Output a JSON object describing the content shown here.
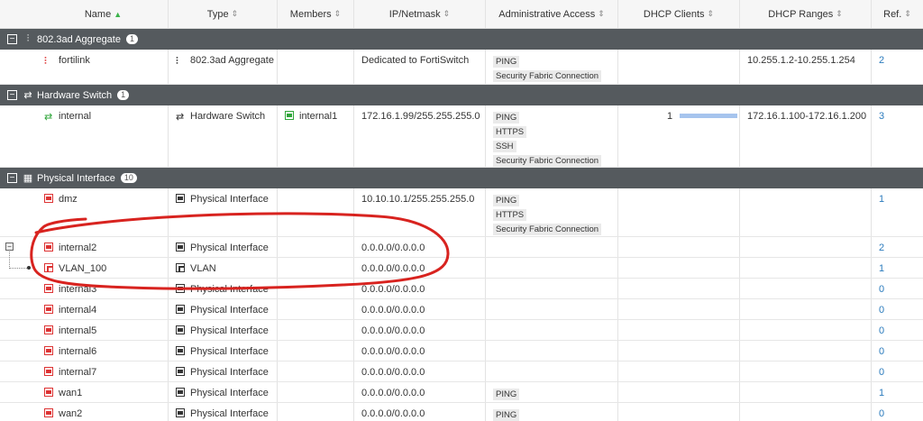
{
  "columns": [
    {
      "label": "Name",
      "sort": "up"
    },
    {
      "label": "Type",
      "sort": "both"
    },
    {
      "label": "Members",
      "sort": "both"
    },
    {
      "label": "IP/Netmask",
      "sort": "both"
    },
    {
      "label": "Administrative Access",
      "sort": "both"
    },
    {
      "label": "DHCP Clients",
      "sort": "both"
    },
    {
      "label": "DHCP Ranges",
      "sort": "both"
    },
    {
      "label": "Ref.",
      "sort": "both"
    }
  ],
  "sort_glyph_up": "▲",
  "sort_glyph_both": "⇕",
  "groups": [
    {
      "toggle": "−",
      "name": "802.3ad Aggregate",
      "count": "1",
      "rows": [
        {
          "name": "fortilink",
          "type": "802.3ad Aggregate",
          "members": "",
          "ip": "Dedicated to FortiSwitch",
          "access": [
            "PING",
            "Security Fabric Connection"
          ],
          "dhcp_clients": "",
          "dhcp_ranges": "10.255.1.2-10.255.1.254",
          "ref": "2"
        }
      ]
    },
    {
      "toggle": "−",
      "name": "Hardware Switch",
      "count": "1",
      "rows": [
        {
          "name": "internal",
          "type": "Hardware Switch",
          "members": "internal1",
          "ip": "172.16.1.99/255.255.255.0",
          "access": [
            "PING",
            "HTTPS",
            "SSH",
            "Security Fabric Connection"
          ],
          "dhcp_clients": "1",
          "dhcp_clients_fraction": 1.0,
          "dhcp_ranges": "172.16.1.100-172.16.1.200",
          "ref": "3"
        }
      ]
    },
    {
      "toggle": "−",
      "name": "Physical Interface",
      "count": "10",
      "rows": [
        {
          "name": "dmz",
          "type": "Physical Interface",
          "members": "",
          "ip": "10.10.10.1/255.255.255.0",
          "access": [
            "PING",
            "HTTPS",
            "Security Fabric Connection"
          ],
          "dhcp_clients": "",
          "dhcp_ranges": "",
          "ref": "1"
        },
        {
          "name": "internal2",
          "type": "Physical Interface",
          "members": "",
          "ip": "0.0.0.0/0.0.0.0",
          "access": [],
          "dhcp_clients": "",
          "dhcp_ranges": "",
          "ref": "2"
        },
        {
          "name": "VLAN_100",
          "type": "VLAN",
          "members": "",
          "ip": "0.0.0.0/0.0.0.0",
          "access": [],
          "dhcp_clients": "",
          "dhcp_ranges": "",
          "ref": "1"
        },
        {
          "name": "internal3",
          "type": "Physical Interface",
          "members": "",
          "ip": "0.0.0.0/0.0.0.0",
          "access": [],
          "dhcp_clients": "",
          "dhcp_ranges": "",
          "ref": "0"
        },
        {
          "name": "internal4",
          "type": "Physical Interface",
          "members": "",
          "ip": "0.0.0.0/0.0.0.0",
          "access": [],
          "dhcp_clients": "",
          "dhcp_ranges": "",
          "ref": "0"
        },
        {
          "name": "internal5",
          "type": "Physical Interface",
          "members": "",
          "ip": "0.0.0.0/0.0.0.0",
          "access": [],
          "dhcp_clients": "",
          "dhcp_ranges": "",
          "ref": "0"
        },
        {
          "name": "internal6",
          "type": "Physical Interface",
          "members": "",
          "ip": "0.0.0.0/0.0.0.0",
          "access": [],
          "dhcp_clients": "",
          "dhcp_ranges": "",
          "ref": "0"
        },
        {
          "name": "internal7",
          "type": "Physical Interface",
          "members": "",
          "ip": "0.0.0.0/0.0.0.0",
          "access": [],
          "dhcp_clients": "",
          "dhcp_ranges": "",
          "ref": "0"
        },
        {
          "name": "wan1",
          "type": "Physical Interface",
          "members": "",
          "ip": "0.0.0.0/0.0.0.0",
          "access": [
            "PING"
          ],
          "dhcp_clients": "",
          "dhcp_ranges": "",
          "ref": "1"
        },
        {
          "name": "wan2",
          "type": "Physical Interface",
          "members": "",
          "ip": "0.0.0.0/0.0.0.0",
          "access": [
            "PING"
          ],
          "dhcp_clients": "",
          "dhcp_ranges": "",
          "ref": "0"
        }
      ]
    }
  ],
  "tree_toggle": "−",
  "colors": {
    "group_bg": "#555a5e",
    "link": "#2b7bbd",
    "annotation": "#d8231f",
    "bar": "#a6c4ee"
  }
}
